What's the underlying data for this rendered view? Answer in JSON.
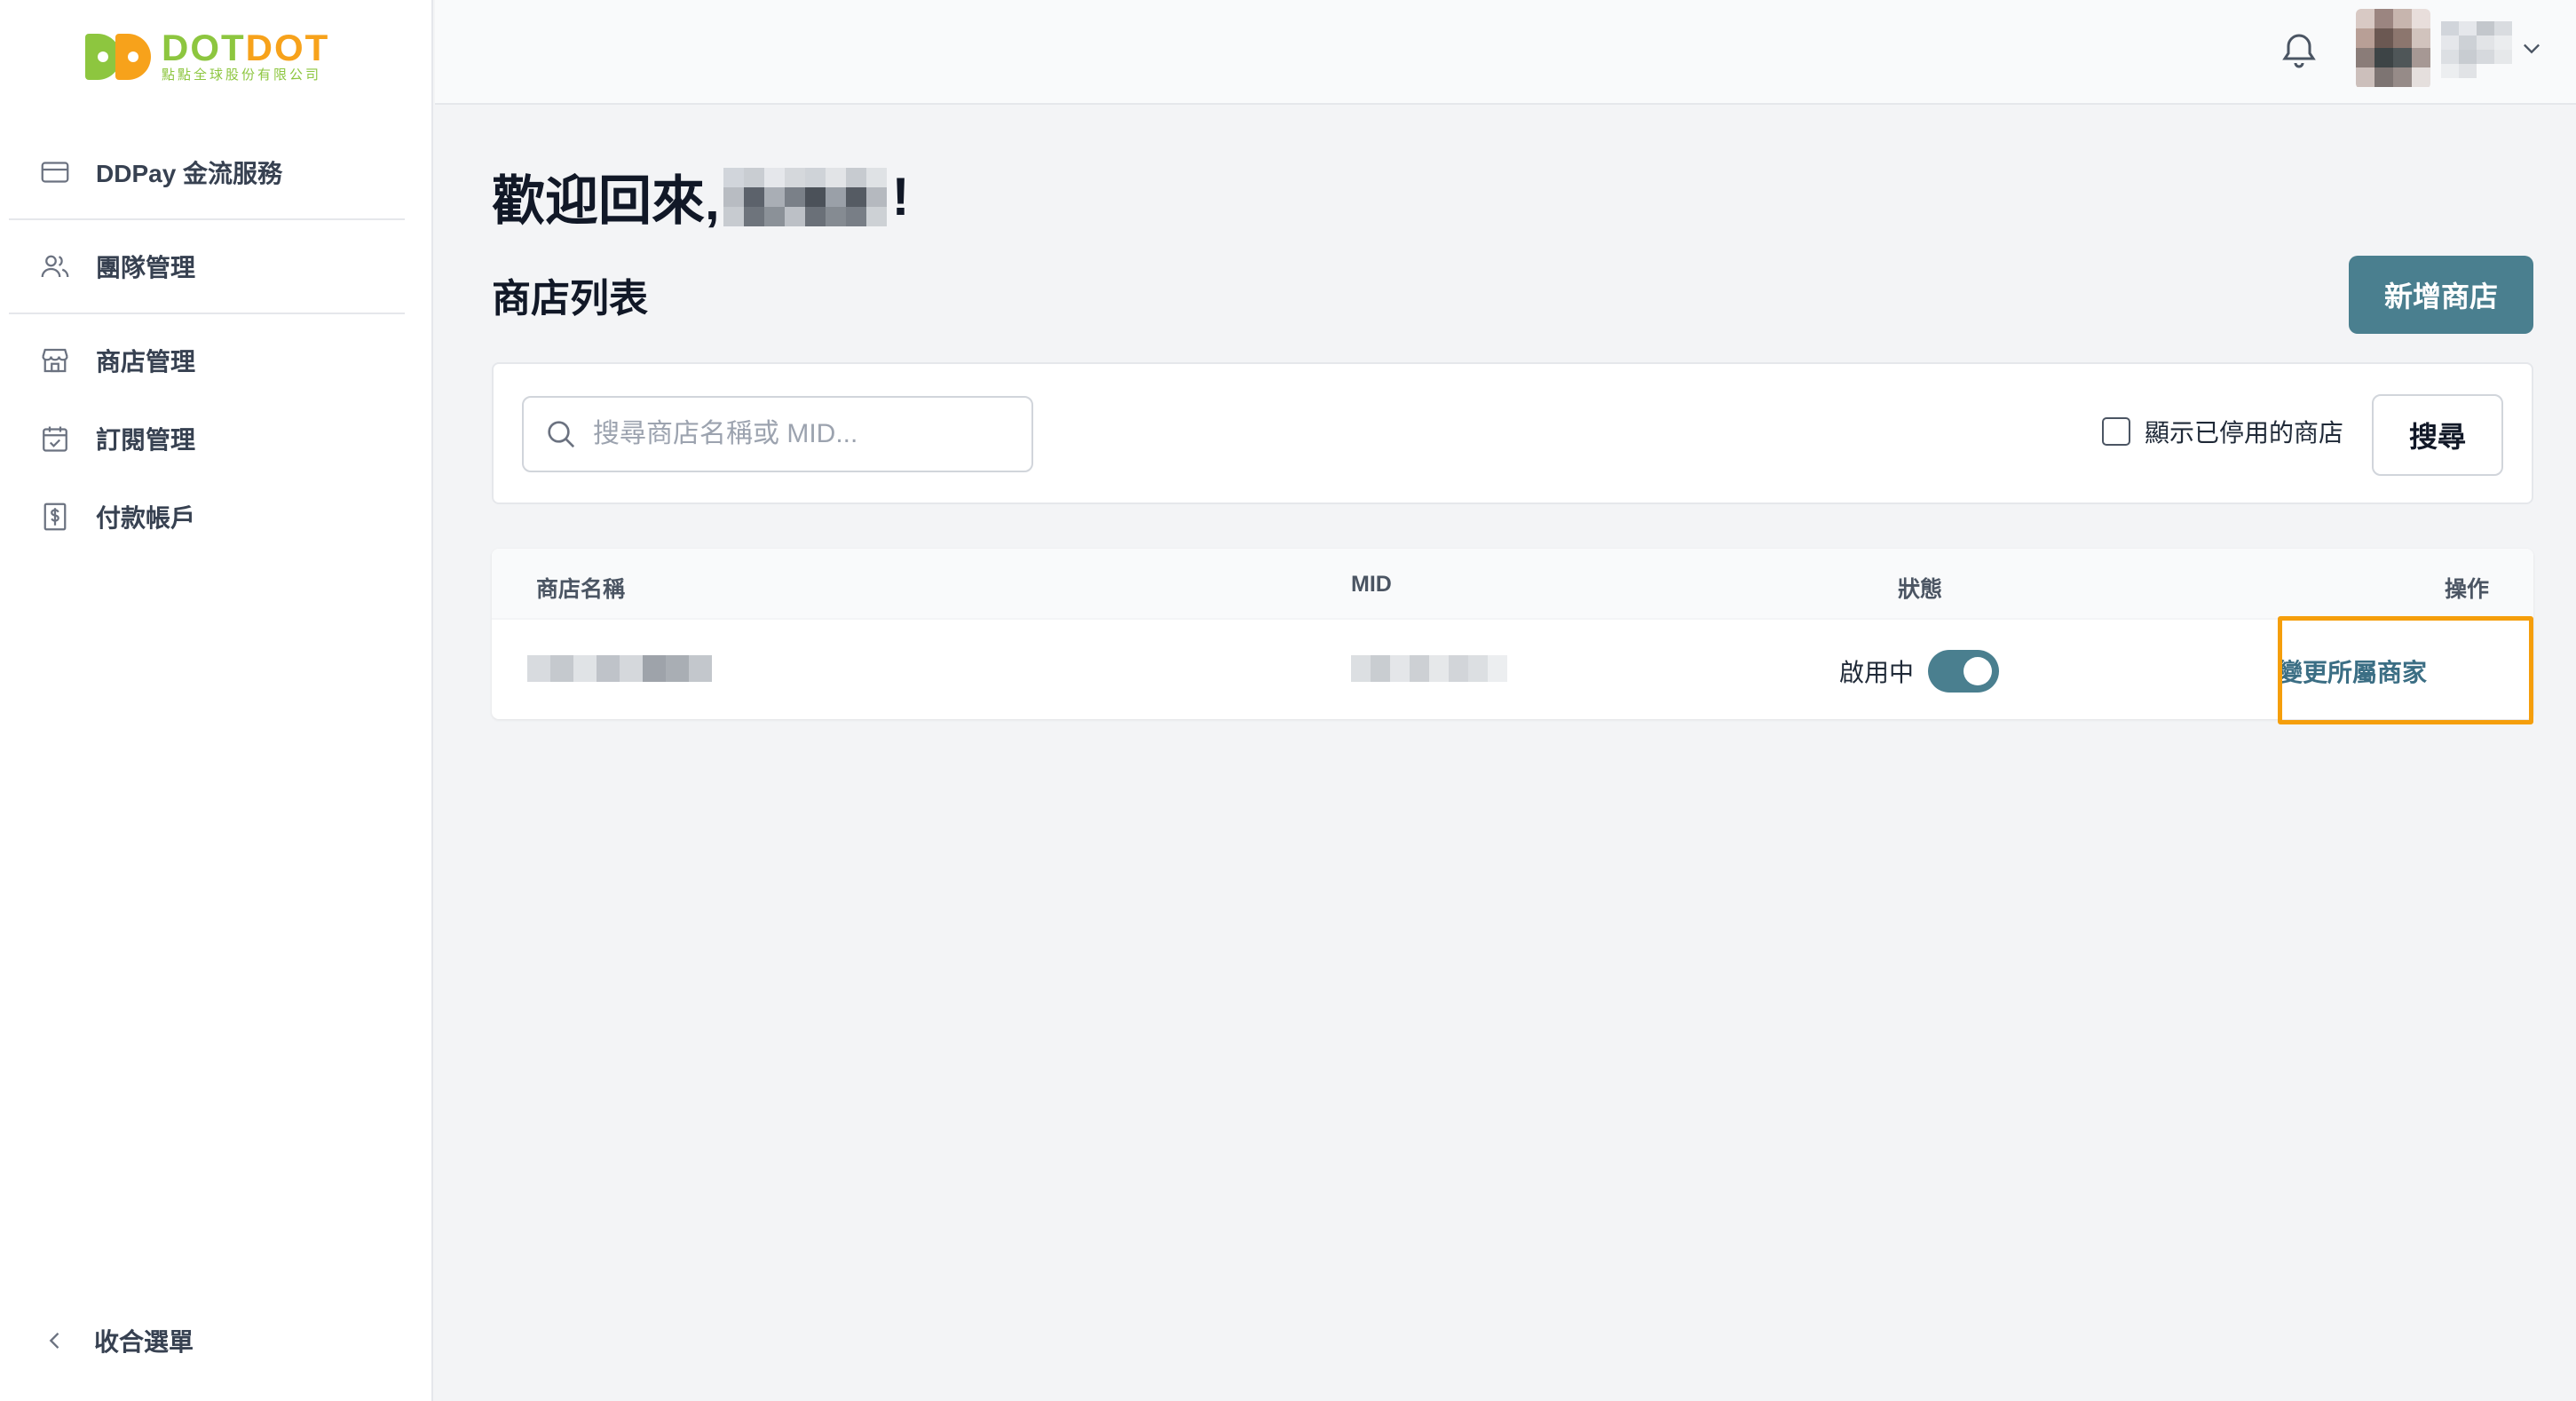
{
  "brand": {
    "name_part1": "DOT",
    "name_part2": "DOT",
    "subtitle": "點點全球股份有限公司"
  },
  "sidebar": {
    "items": [
      {
        "label": "DDPay 金流服務",
        "icon": "credit-card-icon"
      },
      {
        "label": "團隊管理",
        "icon": "users-icon"
      },
      {
        "label": "商店管理",
        "icon": "store-icon"
      },
      {
        "label": "訂閱管理",
        "icon": "calendar-check-icon"
      },
      {
        "label": "付款帳戶",
        "icon": "dollar-receipt-icon"
      }
    ],
    "collapse_label": "收合選單"
  },
  "header": {
    "welcome_prefix": "歡迎回來,",
    "welcome_suffix": "!"
  },
  "main": {
    "section_title": "商店列表",
    "add_store_label": "新增商店",
    "search": {
      "placeholder": "搜尋商店名稱或 MID...",
      "value": "",
      "show_disabled_label": "顯示已停用的商店",
      "show_disabled_checked": false,
      "button_label": "搜尋"
    },
    "table": {
      "columns": [
        "商店名稱",
        "MID",
        "狀態",
        "操作"
      ],
      "rows": [
        {
          "status_label": "啟用中",
          "enabled": true,
          "action_label": "變更所屬商家"
        }
      ]
    }
  },
  "colors": {
    "primary": "#4a7f8f",
    "link": "#3b6e84",
    "highlight": "#f59e0b",
    "brand_green": "#8dc63f",
    "brand_orange": "#f7a21b"
  }
}
